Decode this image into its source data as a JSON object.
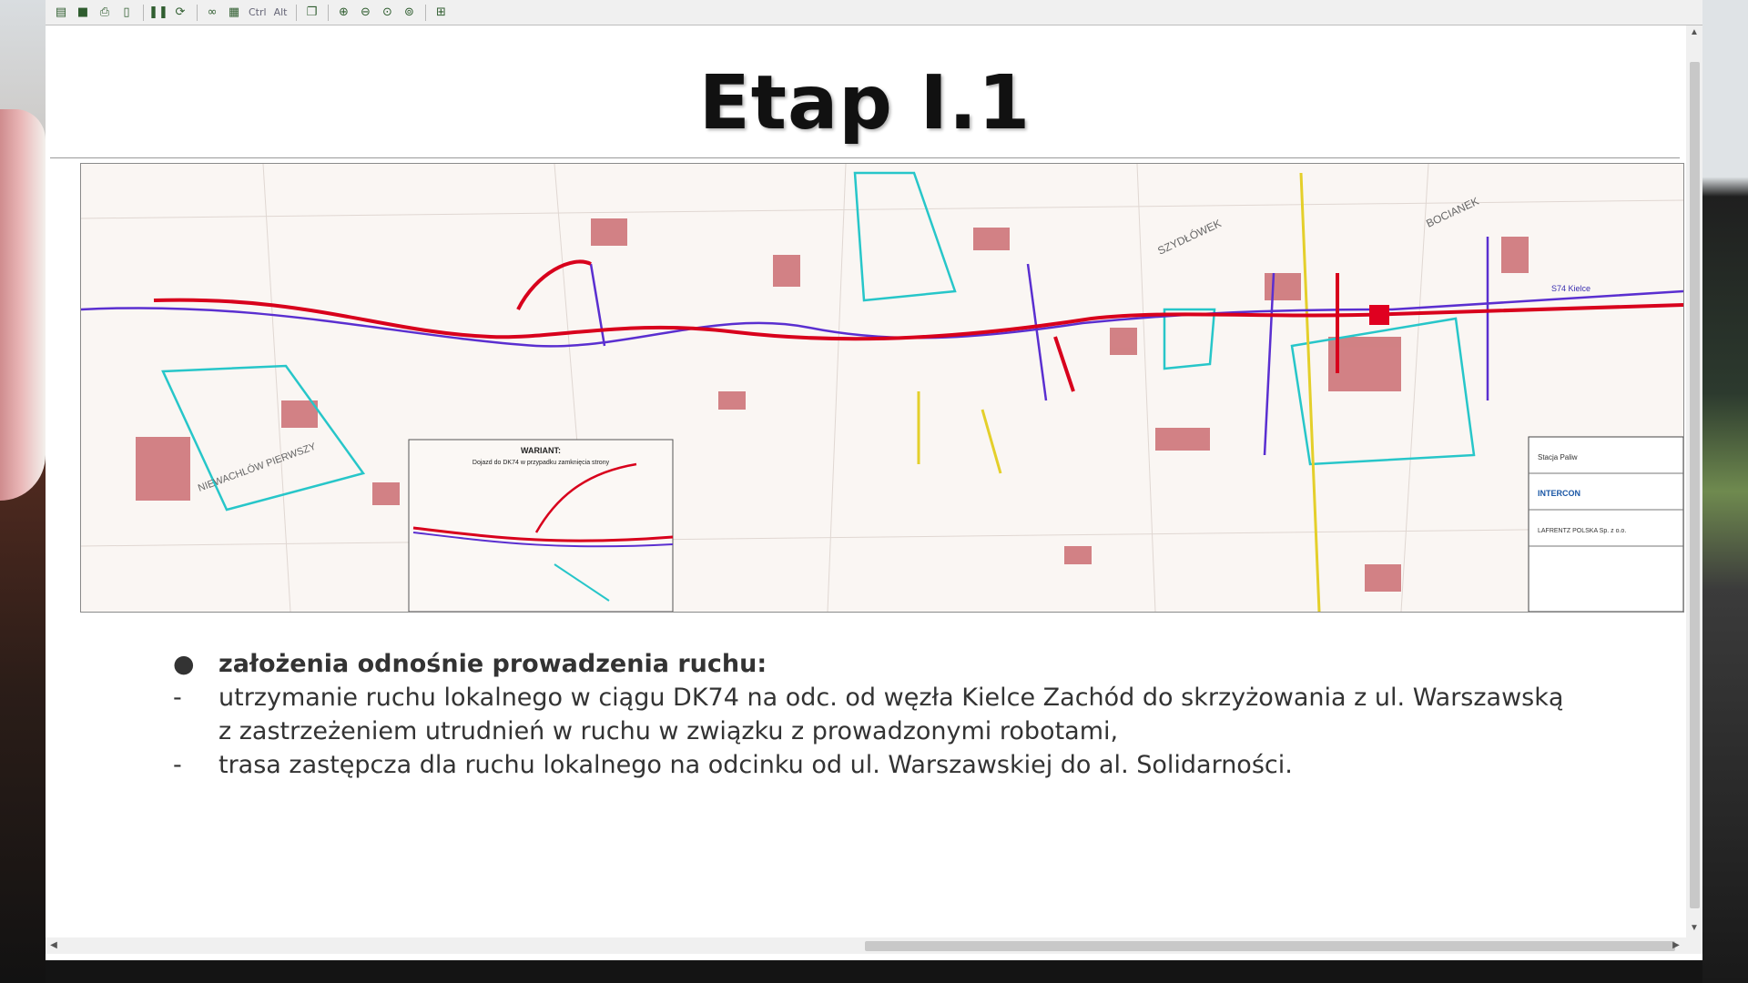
{
  "toolbar": {
    "buttons": [
      "new-icon",
      "save-icon",
      "print-icon",
      "document-icon",
      "pause-icon",
      "refresh-icon",
      "glasses-icon",
      "film-icon",
      "ctrl",
      "alt",
      "copy-icon",
      "zoom-in-icon",
      "zoom-out-icon",
      "zoom-fit-icon",
      "zoom-icon",
      "fullscreen-icon"
    ],
    "ctrl_label": "Ctrl",
    "alt_label": "Alt"
  },
  "slide": {
    "title": "Etap I.1",
    "bullets": [
      {
        "marker": "●",
        "text": "założenia odnośnie prowadzenia ruchu:",
        "bold": true
      },
      {
        "marker": "-",
        "text": "utrzymanie ruchu lokalnego w ciągu DK74 na odc. od węzła Kielce Zachód do skrzyżowania z ul. Warszawską"
      },
      {
        "marker": "",
        "text": "z zastrzeżeniem utrudnień w ruchu w związku z prowadzonymi robotami,"
      },
      {
        "marker": "-",
        "text": "trasa zastępcza dla ruchu lokalnego na odcinku od ul. Warszawskiej do al. Solidarności."
      }
    ]
  },
  "map": {
    "labels": {
      "area_west": "NIEWACHLÓW PIERWSZY",
      "area_mid": "SZYDŁÓWEK",
      "area_east": "BOCIANEK",
      "road_tag": "S74 Kielce",
      "inset_title": "WARIANT:",
      "inset_subtitle": "Dojazd do DK74 w przypadku zamknięcia strony"
    },
    "title_block": {
      "line1": "Stacja Paliw",
      "line2": "INTERCON",
      "line3": "LAFRENTZ POLSKA Sp. z o.o."
    },
    "colors": {
      "road_main": "#d8001c",
      "road_temp": "#5a2fd0",
      "boundary": "#27c6c9",
      "building": "#b8464c",
      "river": "#e4cf2a"
    }
  },
  "scrollbars": {
    "up": "▲",
    "down": "▼",
    "left": "◀",
    "right": "▶"
  }
}
